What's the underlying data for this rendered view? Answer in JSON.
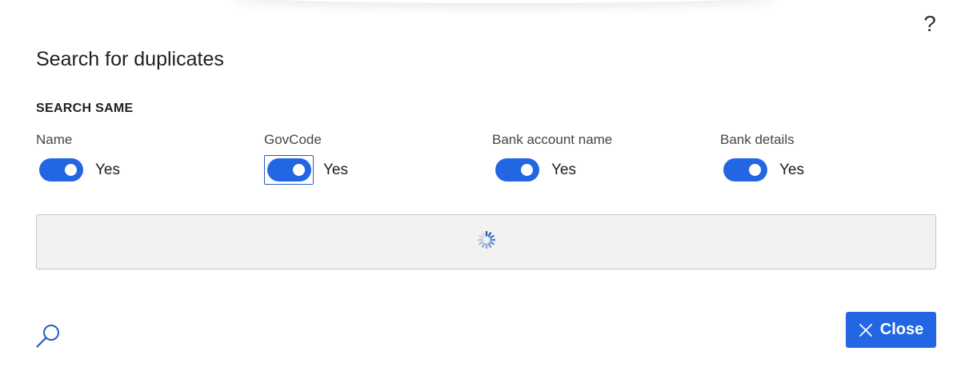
{
  "dialog": {
    "title": "Search for duplicates",
    "help_icon": "?",
    "section_label": "SEARCH SAME"
  },
  "fields": [
    {
      "label": "Name",
      "value_text": "Yes",
      "checked": true
    },
    {
      "label": "GovCode",
      "value_text": "Yes",
      "checked": true,
      "focused": true
    },
    {
      "label": "Bank account name",
      "value_text": "Yes",
      "checked": true
    },
    {
      "label": "Bank details",
      "value_text": "Yes",
      "checked": true
    }
  ],
  "loader": {
    "state": "loading",
    "icon": "spinner-icon"
  },
  "footer": {
    "search_icon": "search-icon",
    "close_label": "Close",
    "close_icon": "close-icon"
  },
  "colors": {
    "accent": "#2266e3",
    "panel_bg": "#f3f2f1",
    "panel_border": "#c8c6c4",
    "text": "#201f1e",
    "label_text": "#484644"
  }
}
